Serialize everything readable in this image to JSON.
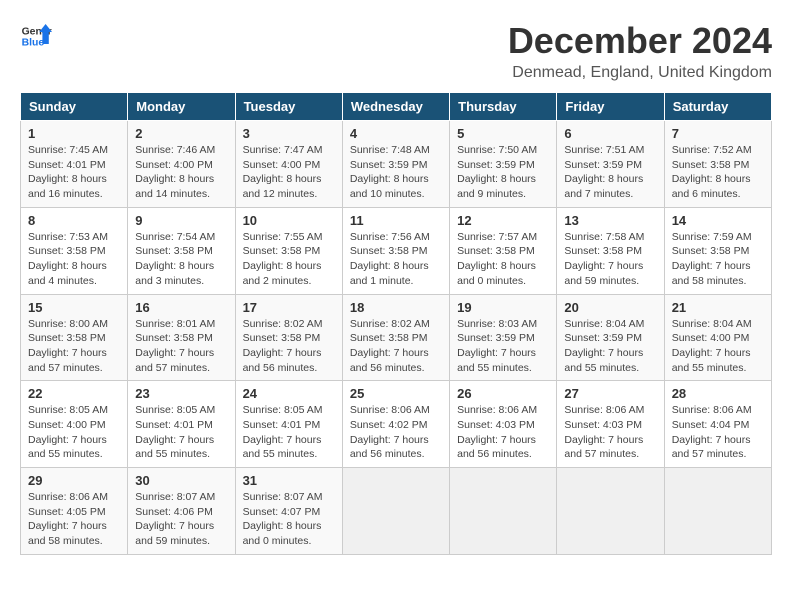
{
  "logo": {
    "text_general": "General",
    "text_blue": "Blue"
  },
  "title": "December 2024",
  "subtitle": "Denmead, England, United Kingdom",
  "days_of_week": [
    "Sunday",
    "Monday",
    "Tuesday",
    "Wednesday",
    "Thursday",
    "Friday",
    "Saturday"
  ],
  "weeks": [
    [
      {
        "day": "1",
        "info": "Sunrise: 7:45 AM\nSunset: 4:01 PM\nDaylight: 8 hours\nand 16 minutes."
      },
      {
        "day": "2",
        "info": "Sunrise: 7:46 AM\nSunset: 4:00 PM\nDaylight: 8 hours\nand 14 minutes."
      },
      {
        "day": "3",
        "info": "Sunrise: 7:47 AM\nSunset: 4:00 PM\nDaylight: 8 hours\nand 12 minutes."
      },
      {
        "day": "4",
        "info": "Sunrise: 7:48 AM\nSunset: 3:59 PM\nDaylight: 8 hours\nand 10 minutes."
      },
      {
        "day": "5",
        "info": "Sunrise: 7:50 AM\nSunset: 3:59 PM\nDaylight: 8 hours\nand 9 minutes."
      },
      {
        "day": "6",
        "info": "Sunrise: 7:51 AM\nSunset: 3:59 PM\nDaylight: 8 hours\nand 7 minutes."
      },
      {
        "day": "7",
        "info": "Sunrise: 7:52 AM\nSunset: 3:58 PM\nDaylight: 8 hours\nand 6 minutes."
      }
    ],
    [
      {
        "day": "8",
        "info": "Sunrise: 7:53 AM\nSunset: 3:58 PM\nDaylight: 8 hours\nand 4 minutes."
      },
      {
        "day": "9",
        "info": "Sunrise: 7:54 AM\nSunset: 3:58 PM\nDaylight: 8 hours\nand 3 minutes."
      },
      {
        "day": "10",
        "info": "Sunrise: 7:55 AM\nSunset: 3:58 PM\nDaylight: 8 hours\nand 2 minutes."
      },
      {
        "day": "11",
        "info": "Sunrise: 7:56 AM\nSunset: 3:58 PM\nDaylight: 8 hours\nand 1 minute."
      },
      {
        "day": "12",
        "info": "Sunrise: 7:57 AM\nSunset: 3:58 PM\nDaylight: 8 hours\nand 0 minutes."
      },
      {
        "day": "13",
        "info": "Sunrise: 7:58 AM\nSunset: 3:58 PM\nDaylight: 7 hours\nand 59 minutes."
      },
      {
        "day": "14",
        "info": "Sunrise: 7:59 AM\nSunset: 3:58 PM\nDaylight: 7 hours\nand 58 minutes."
      }
    ],
    [
      {
        "day": "15",
        "info": "Sunrise: 8:00 AM\nSunset: 3:58 PM\nDaylight: 7 hours\nand 57 minutes."
      },
      {
        "day": "16",
        "info": "Sunrise: 8:01 AM\nSunset: 3:58 PM\nDaylight: 7 hours\nand 57 minutes."
      },
      {
        "day": "17",
        "info": "Sunrise: 8:02 AM\nSunset: 3:58 PM\nDaylight: 7 hours\nand 56 minutes."
      },
      {
        "day": "18",
        "info": "Sunrise: 8:02 AM\nSunset: 3:58 PM\nDaylight: 7 hours\nand 56 minutes."
      },
      {
        "day": "19",
        "info": "Sunrise: 8:03 AM\nSunset: 3:59 PM\nDaylight: 7 hours\nand 55 minutes."
      },
      {
        "day": "20",
        "info": "Sunrise: 8:04 AM\nSunset: 3:59 PM\nDaylight: 7 hours\nand 55 minutes."
      },
      {
        "day": "21",
        "info": "Sunrise: 8:04 AM\nSunset: 4:00 PM\nDaylight: 7 hours\nand 55 minutes."
      }
    ],
    [
      {
        "day": "22",
        "info": "Sunrise: 8:05 AM\nSunset: 4:00 PM\nDaylight: 7 hours\nand 55 minutes."
      },
      {
        "day": "23",
        "info": "Sunrise: 8:05 AM\nSunset: 4:01 PM\nDaylight: 7 hours\nand 55 minutes."
      },
      {
        "day": "24",
        "info": "Sunrise: 8:05 AM\nSunset: 4:01 PM\nDaylight: 7 hours\nand 55 minutes."
      },
      {
        "day": "25",
        "info": "Sunrise: 8:06 AM\nSunset: 4:02 PM\nDaylight: 7 hours\nand 56 minutes."
      },
      {
        "day": "26",
        "info": "Sunrise: 8:06 AM\nSunset: 4:03 PM\nDaylight: 7 hours\nand 56 minutes."
      },
      {
        "day": "27",
        "info": "Sunrise: 8:06 AM\nSunset: 4:03 PM\nDaylight: 7 hours\nand 57 minutes."
      },
      {
        "day": "28",
        "info": "Sunrise: 8:06 AM\nSunset: 4:04 PM\nDaylight: 7 hours\nand 57 minutes."
      }
    ],
    [
      {
        "day": "29",
        "info": "Sunrise: 8:06 AM\nSunset: 4:05 PM\nDaylight: 7 hours\nand 58 minutes."
      },
      {
        "day": "30",
        "info": "Sunrise: 8:07 AM\nSunset: 4:06 PM\nDaylight: 7 hours\nand 59 minutes."
      },
      {
        "day": "31",
        "info": "Sunrise: 8:07 AM\nSunset: 4:07 PM\nDaylight: 8 hours\nand 0 minutes."
      },
      null,
      null,
      null,
      null
    ]
  ]
}
